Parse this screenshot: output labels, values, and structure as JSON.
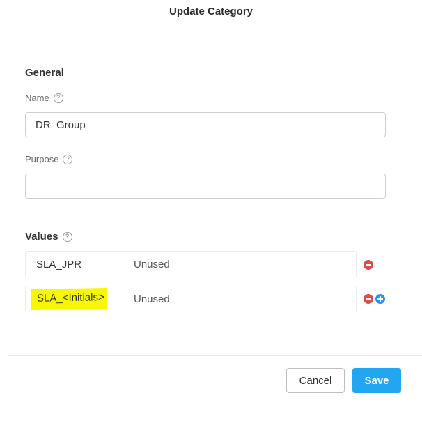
{
  "dialog": {
    "title": "Update Category"
  },
  "general": {
    "section_title": "General",
    "name": {
      "label": "Name",
      "help": "?",
      "value": "DR_Group",
      "placeholder": ""
    },
    "purpose": {
      "label": "Purpose",
      "help": "?",
      "value": "",
      "placeholder": ""
    }
  },
  "values": {
    "section_title": "Values",
    "help": "?",
    "rows": [
      {
        "name": "SLA_JPR",
        "status": "Unused"
      },
      {
        "name": "SLA_<Initials>",
        "status": "Unused"
      }
    ]
  },
  "footer": {
    "cancel_label": "Cancel",
    "save_label": "Save"
  },
  "colors": {
    "primary": "#22a6f0",
    "remove": "#e04a4a",
    "add": "#2196f3",
    "highlight": "#f7f700"
  }
}
